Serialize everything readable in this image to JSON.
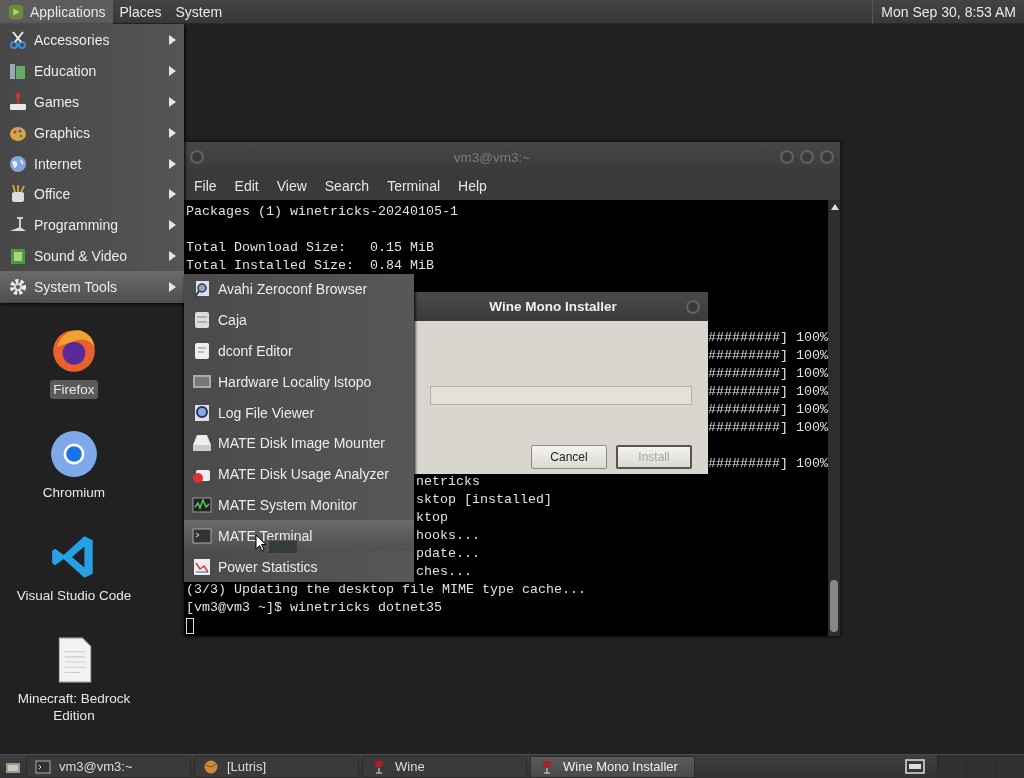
{
  "top_panel": {
    "menus": [
      {
        "label": "Applications",
        "selected": true
      },
      {
        "label": "Places",
        "selected": false
      },
      {
        "label": "System",
        "selected": false
      }
    ],
    "clock": "Mon Sep 30, 8:53 AM"
  },
  "desktop_icons": [
    {
      "label": "Firefox",
      "selected": true
    },
    {
      "label": "Chromium",
      "selected": false
    },
    {
      "label": "Visual Studio Code",
      "selected": false
    },
    {
      "label": "Minecraft: Bedrock Edition",
      "selected": false
    }
  ],
  "terminal": {
    "title": "vm3@vm3:~",
    "menu": [
      "File",
      "Edit",
      "View",
      "Search",
      "Terminal",
      "Help"
    ],
    "lines": [
      {
        "kind": "full",
        "text": "Packages (1) winetricks-20240105-1"
      },
      {
        "kind": "blank"
      },
      {
        "kind": "full",
        "text": "Total Download Size:   0.15 MiB"
      },
      {
        "kind": "full",
        "text": "Total Installed Size:  0.84 MiB"
      },
      {
        "kind": "blank"
      },
      {
        "kind": "blank"
      },
      {
        "kind": "blank"
      },
      {
        "kind": "right-of-dialog",
        "text": "#########] 100%"
      },
      {
        "kind": "right-of-dialog",
        "text": "#########] 100%"
      },
      {
        "kind": "right-of-dialog",
        "text": "#########] 100%"
      },
      {
        "kind": "right-of-dialog",
        "text": "#########] 100%"
      },
      {
        "kind": "right-of-dialog",
        "text": "#########] 100%"
      },
      {
        "kind": "right-of-dialog",
        "text": "#########] 100%"
      },
      {
        "kind": "blank"
      },
      {
        "kind": "right-of-dialog",
        "text": "#########] 100%"
      },
      {
        "kind": "right-of-menu",
        "text": "netricks"
      },
      {
        "kind": "right-of-menu",
        "text": "sktop [installed]"
      },
      {
        "kind": "right-of-menu",
        "text": "ktop"
      },
      {
        "kind": "right-of-menu",
        "text": "hooks..."
      },
      {
        "kind": "right-of-menu",
        "text": "pdate..."
      },
      {
        "kind": "right-of-menu",
        "text": "ches..."
      },
      {
        "kind": "full",
        "text": "(3/3) Updating the desktop file MIME type cache..."
      },
      {
        "kind": "full",
        "text": "[vm3@vm3 ~]$ winetricks dotnet35"
      },
      {
        "kind": "cursor"
      }
    ]
  },
  "dialog": {
    "title": "Wine Mono Installer",
    "progress": {
      "level": 0
    },
    "buttons": [
      {
        "label": "Cancel",
        "disabled": false
      },
      {
        "label": "Install",
        "disabled": true
      }
    ]
  },
  "applications_menu": {
    "items": [
      {
        "label": "Accessories",
        "selected": false
      },
      {
        "label": "Education",
        "selected": false
      },
      {
        "label": "Games",
        "selected": false
      },
      {
        "label": "Graphics",
        "selected": false
      },
      {
        "label": "Internet",
        "selected": false
      },
      {
        "label": "Office",
        "selected": false
      },
      {
        "label": "Programming",
        "selected": false
      },
      {
        "label": "Sound & Video",
        "selected": false
      },
      {
        "label": "System Tools",
        "selected": true
      }
    ]
  },
  "system_tools_menu": {
    "items": [
      {
        "label": "Avahi Zeroconf Browser",
        "selected": false
      },
      {
        "label": "Caja",
        "selected": false
      },
      {
        "label": "dconf Editor",
        "selected": false
      },
      {
        "label": "Hardware Locality lstopo",
        "selected": false
      },
      {
        "label": "Log File Viewer",
        "selected": false
      },
      {
        "label": "MATE Disk Image Mounter",
        "selected": false
      },
      {
        "label": "MATE Disk Usage Analyzer",
        "selected": false
      },
      {
        "label": "MATE System Monitor",
        "selected": false
      },
      {
        "label": "MATE Terminal",
        "selected": true
      },
      {
        "label": "Power Statistics",
        "selected": false
      }
    ]
  },
  "taskbar": {
    "tasks": [
      {
        "label": "vm3@vm3:~",
        "selected": false
      },
      {
        "label": "[Lutris]",
        "selected": false
      },
      {
        "label": "Wine",
        "selected": false
      },
      {
        "label": "Wine Mono Installer",
        "selected": true
      }
    ]
  }
}
